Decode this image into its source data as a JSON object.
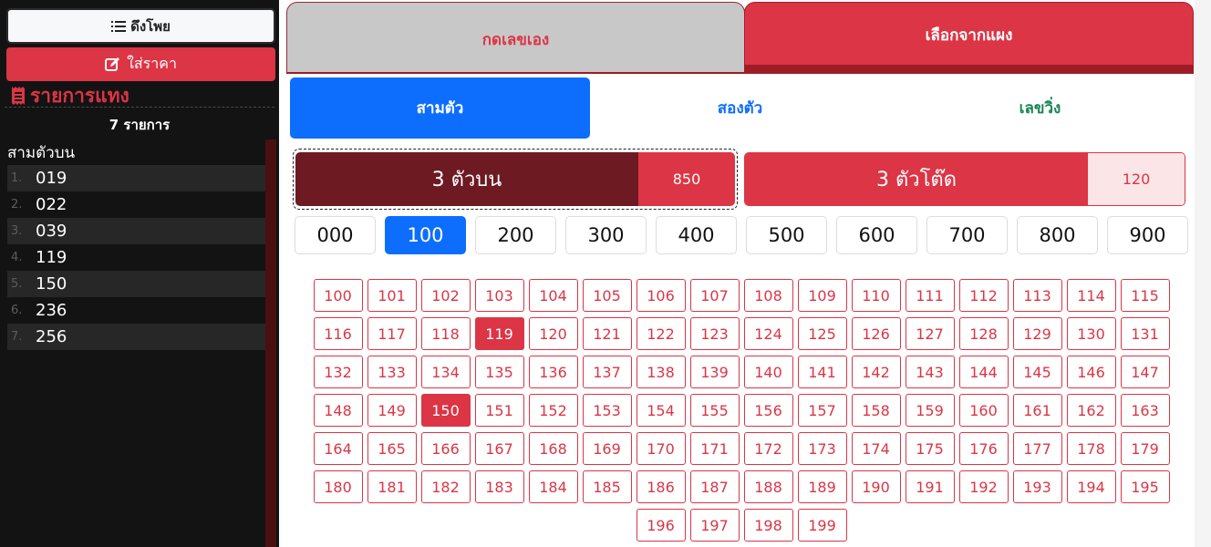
{
  "sidebar": {
    "pull_label": "ดึงโพย",
    "price_label": "ใส่ราคา",
    "bets_title": "รายการแทง",
    "bets_count": "7 รายการ",
    "group_label": "สามตัวบน",
    "bets": [
      {
        "idx": "1.",
        "num": "019"
      },
      {
        "idx": "2.",
        "num": "022"
      },
      {
        "idx": "3.",
        "num": "039"
      },
      {
        "idx": "4.",
        "num": "119"
      },
      {
        "idx": "5.",
        "num": "150"
      },
      {
        "idx": "6.",
        "num": "236"
      },
      {
        "idx": "7.",
        "num": "256"
      }
    ]
  },
  "tabs": {
    "manual": "กดเลขเอง",
    "panel": "เลือกจากแผง"
  },
  "modes": {
    "three": "สามตัว",
    "two": "สองตัว",
    "run": "เลขวิ่ง"
  },
  "bet_types": {
    "top": {
      "label": "3 ตัวบน",
      "price": "850"
    },
    "tod": {
      "label": "3 ตัวโต๊ด",
      "price": "120"
    }
  },
  "hundreds": [
    "000",
    "100",
    "200",
    "300",
    "400",
    "500",
    "600",
    "700",
    "800",
    "900"
  ],
  "hundreds_active": "100",
  "numbers": [
    "100",
    "101",
    "102",
    "103",
    "104",
    "105",
    "106",
    "107",
    "108",
    "109",
    "110",
    "111",
    "112",
    "113",
    "114",
    "115",
    "116",
    "117",
    "118",
    "119",
    "120",
    "121",
    "122",
    "123",
    "124",
    "125",
    "126",
    "127",
    "128",
    "129",
    "130",
    "131",
    "132",
    "133",
    "134",
    "135",
    "136",
    "137",
    "138",
    "139",
    "140",
    "141",
    "142",
    "143",
    "144",
    "145",
    "146",
    "147",
    "148",
    "149",
    "150",
    "151",
    "152",
    "153",
    "154",
    "155",
    "156",
    "157",
    "158",
    "159",
    "160",
    "161",
    "162",
    "163",
    "164",
    "165",
    "166",
    "167",
    "168",
    "169",
    "170",
    "171",
    "172",
    "173",
    "174",
    "175",
    "176",
    "177",
    "178",
    "179",
    "180",
    "181",
    "182",
    "183",
    "184",
    "185",
    "186",
    "187",
    "188",
    "189",
    "190",
    "191",
    "192",
    "193",
    "194",
    "195",
    "196",
    "197",
    "198",
    "199"
  ],
  "selected_numbers": [
    "119",
    "150"
  ],
  "colors": {
    "accent": "#dc3545",
    "dark_accent": "#6d1a23",
    "primary": "#0d6efd",
    "success": "#198754"
  },
  "icons": {
    "pull": "list-icon",
    "price": "edit-icon",
    "bets": "receipt-icon"
  }
}
